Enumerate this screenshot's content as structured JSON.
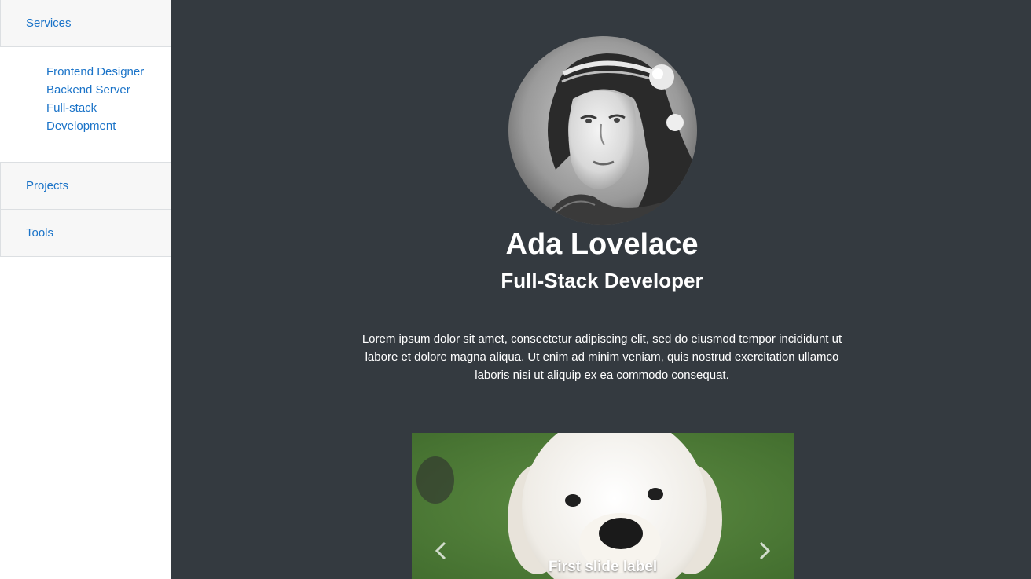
{
  "sidebar": {
    "services_label": "Services",
    "services_items": [
      "Frontend Designer",
      "Backend Server",
      "Full-stack",
      "Development"
    ],
    "projects_label": "Projects",
    "tools_label": "Tools"
  },
  "profile": {
    "name": "Ada Lovelace",
    "role": "Full-Stack Developer",
    "bio": "Lorem ipsum dolor sit amet, consectetur adipiscing elit, sed do eiusmod tempor incididunt ut labore et dolore magna aliqua. Ut enim ad minim veniam, quis nostrud exercitation ullamco laboris nisi ut aliquip ex ea commodo consequat."
  },
  "carousel": {
    "caption": "First slide label",
    "prev_icon": "chevron-left-icon",
    "next_icon": "chevron-right-icon"
  },
  "colors": {
    "main_bg": "#343a40",
    "link": "#1a73c8",
    "sidebar_header_bg": "#f7f7f7"
  }
}
